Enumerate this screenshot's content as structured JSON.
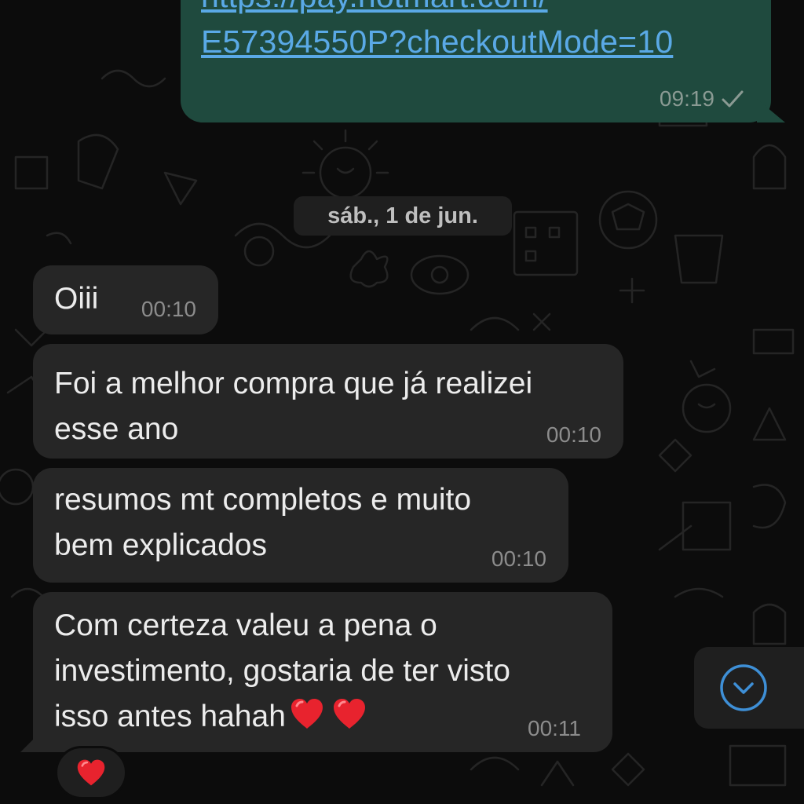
{
  "outgoing": {
    "link_line1": "https://pay.hotmart.com/",
    "link_line2": "E57394550P?checkoutMode=10",
    "time": "09:19",
    "status_icon": "single-check-icon"
  },
  "date_separator": "sáb., 1 de jun.",
  "incoming": [
    {
      "lines": [
        "Oiii"
      ],
      "time": "00:10"
    },
    {
      "lines": [
        "Foi a melhor compra que já realizei",
        "esse ano"
      ],
      "time": "00:10"
    },
    {
      "lines": [
        "resumos mt completos e muito",
        "bem explicados"
      ],
      "time": "00:10"
    },
    {
      "lines": [
        "Com certeza valeu a pena o",
        "investimento, gostaria de ter visto",
        "isso antes hahah"
      ],
      "time": "00:11"
    }
  ],
  "reaction": {
    "icon": "red-heart-icon"
  },
  "scroll_button": {
    "icon": "chevron-down-icon"
  },
  "colors": {
    "outgoing_bubble": "#1f4a3e",
    "incoming_bubble": "#262626",
    "link": "#5aa9e6",
    "heart": "#e8232e",
    "accent_blue": "#3e8fd6"
  }
}
